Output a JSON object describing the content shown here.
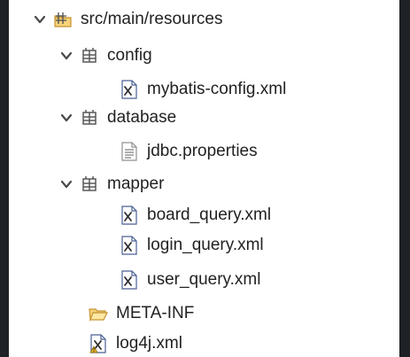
{
  "tree": {
    "root": {
      "label": "src/main/resources",
      "icon": "source-folder-icon"
    },
    "items": [
      {
        "label": "config",
        "icon": "package-icon",
        "expanded": true
      },
      {
        "label": "mybatis-config.xml",
        "icon": "xml-file-icon"
      },
      {
        "label": "database",
        "icon": "package-icon",
        "expanded": true
      },
      {
        "label": "jdbc.properties",
        "icon": "properties-file-icon"
      },
      {
        "label": "mapper",
        "icon": "package-icon",
        "expanded": true
      },
      {
        "label": "board_query.xml",
        "icon": "xml-file-icon"
      },
      {
        "label": "login_query.xml",
        "icon": "xml-file-icon"
      },
      {
        "label": "user_query.xml",
        "icon": "xml-file-icon"
      },
      {
        "label": "META-INF",
        "icon": "open-folder-icon"
      },
      {
        "label": "log4j.xml",
        "icon": "warning-xml-file-icon"
      }
    ]
  },
  "colors": {
    "background": "#1e2125",
    "panel": "#ffffff",
    "text": "#222222",
    "chevron": "#4a4a4a",
    "folder": "#e4a93d",
    "xml": "#4a5f93",
    "warning": "#e6b629"
  }
}
